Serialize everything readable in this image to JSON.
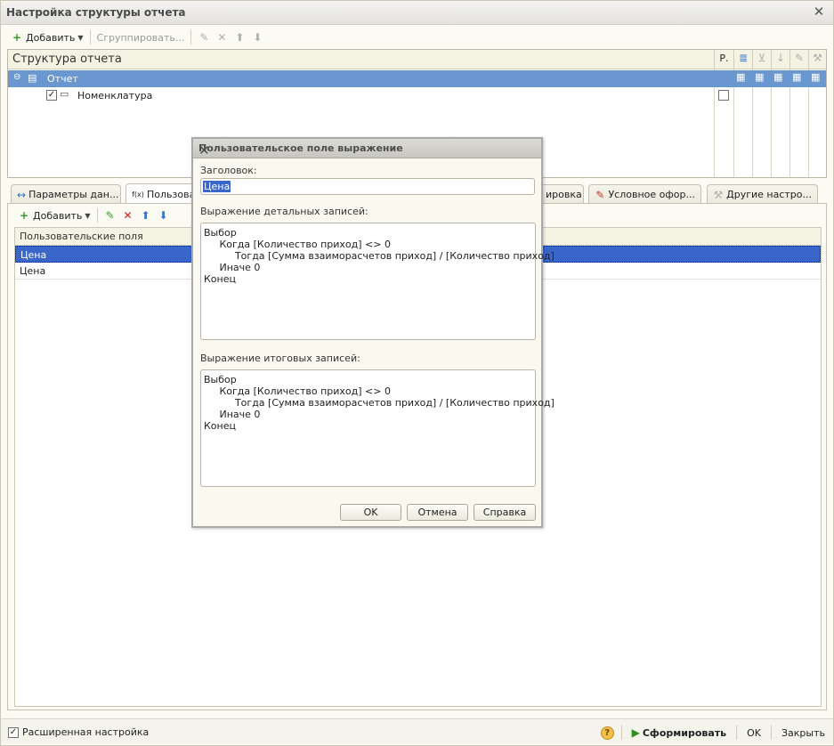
{
  "window": {
    "title": "Настройка структуры отчета",
    "close_glyph": "✕"
  },
  "toolbar": {
    "add_label": "Добавить",
    "group_label": "Сгруппировать..."
  },
  "structure": {
    "title": "Структура отчета",
    "col_r": "Р.",
    "root": "Отчет",
    "child": "Номенклатура"
  },
  "tabs": [
    {
      "label": "Параметры дан...",
      "icon": "arrows-icon"
    },
    {
      "label": "Пользова",
      "icon": "fx-icon"
    },
    {
      "label": "ировка",
      "icon": ""
    },
    {
      "label": "Условное офор...",
      "icon": "pen-icon"
    },
    {
      "label": "Другие настро...",
      "icon": "wrench-icon"
    }
  ],
  "fields": {
    "add_label": "Добавить",
    "header": "Пользовательские поля",
    "rows": [
      "Цена",
      "Цена"
    ]
  },
  "status": {
    "extended_label": "Расширенная настройка",
    "generate_label": "Сформировать",
    "ok_label": "OK",
    "close_label": "Закрыть"
  },
  "dialog": {
    "title": "Пользовательское поле выражение",
    "caption_label": "Заголовок:",
    "caption_value": "Цена",
    "detail_label": "Выражение детальных записей:",
    "detail_expr": "Выбор\n     Когда [Количество приход] <> 0\n          Тогда [Сумма взаиморасчетов приход] / [Количество приход]\n     Иначе 0\nКонец",
    "total_label": "Выражение итоговых записей:",
    "total_expr": "Выбор\n     Когда [Количество приход] <> 0\n          Тогда [Сумма взаиморасчетов приход] / [Количество приход]\n     Иначе 0\nКонец",
    "ok": "OK",
    "cancel": "Отмена",
    "help": "Справка"
  },
  "colors": {
    "selection": "#6a97cf",
    "field_selection": "#3a66c9",
    "accent_green": "#2f8f1f"
  }
}
